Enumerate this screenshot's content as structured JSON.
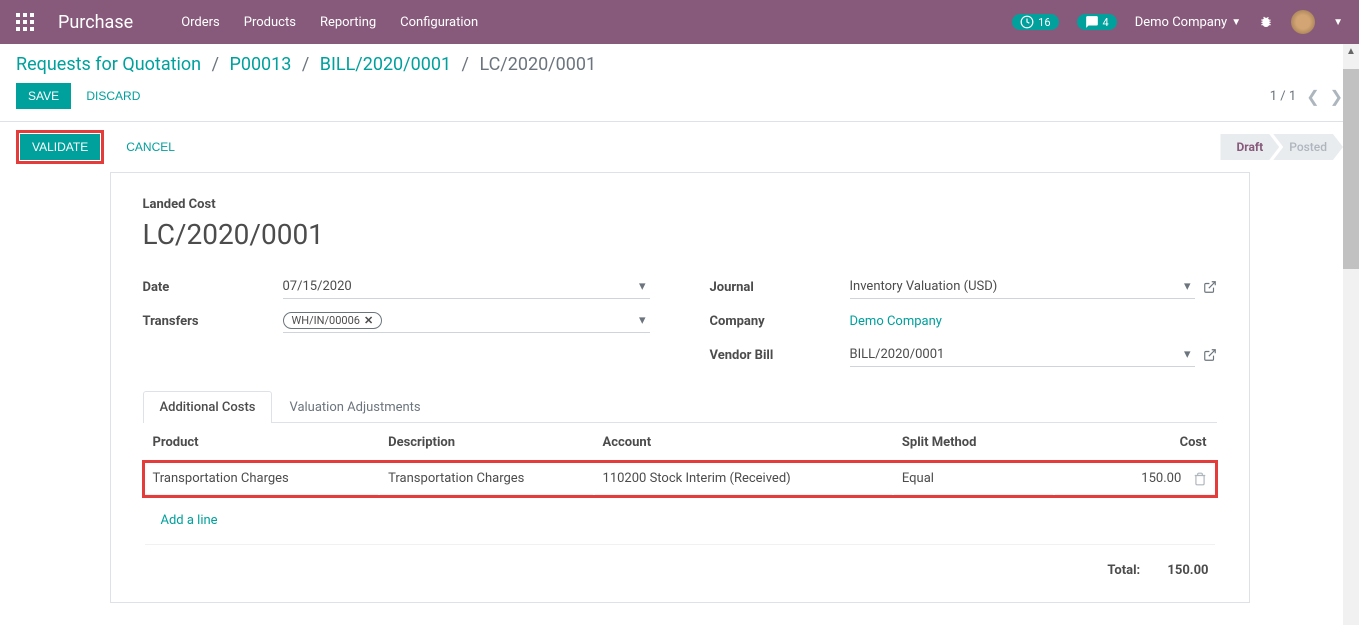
{
  "topbar": {
    "app_title": "Purchase",
    "menu": [
      "Orders",
      "Products",
      "Reporting",
      "Configuration"
    ],
    "clock_badge": "16",
    "chat_badge": "4",
    "company": "Demo Company"
  },
  "breadcrumb": {
    "items": [
      "Requests for Quotation",
      "P00013",
      "BILL/2020/0001"
    ],
    "current": "LC/2020/0001"
  },
  "actions": {
    "save": "Save",
    "discard": "Discard",
    "pager": "1 / 1"
  },
  "status": {
    "validate": "Validate",
    "cancel": "Cancel",
    "steps": [
      {
        "label": "Draft",
        "active": true
      },
      {
        "label": "Posted",
        "active": false
      }
    ]
  },
  "form": {
    "title_label": "Landed Cost",
    "title": "LC/2020/0001",
    "date_label": "Date",
    "date_value": "07/15/2020",
    "transfers_label": "Transfers",
    "transfers_tag": "WH/IN/00006",
    "journal_label": "Journal",
    "journal_value": "Inventory Valuation (USD)",
    "company_label": "Company",
    "company_value": "Demo Company",
    "vendor_bill_label": "Vendor Bill",
    "vendor_bill_value": "BILL/2020/0001"
  },
  "tabs": {
    "additional_costs": "Additional Costs",
    "valuation_adjustments": "Valuation Adjustments"
  },
  "cost_table": {
    "headers": {
      "product": "Product",
      "description": "Description",
      "account": "Account",
      "split_method": "Split Method",
      "cost": "Cost"
    },
    "rows": [
      {
        "product": "Transportation Charges",
        "description": "Transportation Charges",
        "account": "110200 Stock Interim (Received)",
        "split_method": "Equal",
        "cost": "150.00"
      }
    ],
    "add_line": "Add a line",
    "total_label": "Total:",
    "total_value": "150.00"
  }
}
